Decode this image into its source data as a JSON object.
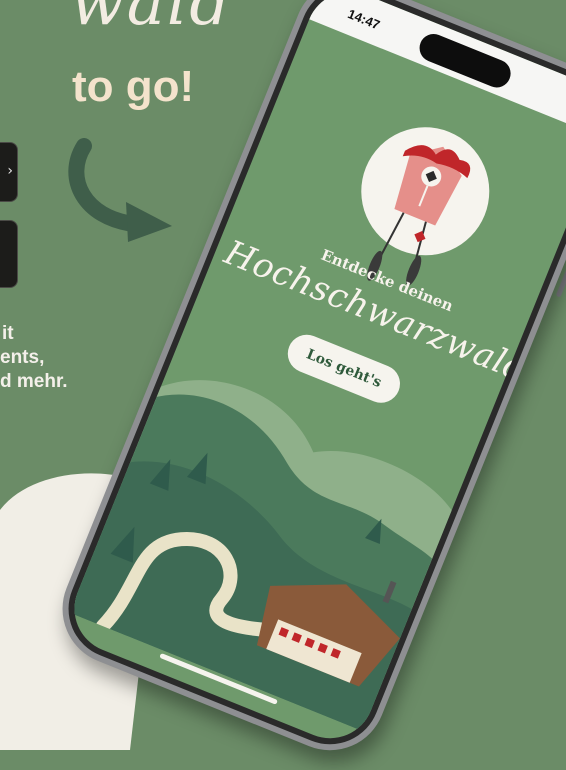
{
  "promo": {
    "script_headline": "wald",
    "headline": "to go!",
    "body_lines": [
      "it",
      "ents,",
      "d mehr."
    ]
  },
  "badges": [
    {
      "icon": "chevron-right-icon"
    },
    {
      "icon": "store-badge"
    }
  ],
  "app_screen": {
    "status_time": "14:47",
    "tagline": "Entdecke deinen",
    "title_script": "Hochschwarzwald",
    "cta_label": "Los geht's"
  },
  "colors": {
    "background": "#6b8c67",
    "screen_green": "#6f9a6c",
    "headline_peach": "#f4e3cc",
    "cream": "#f6f4ee",
    "arrow": "#3f5e4a"
  }
}
